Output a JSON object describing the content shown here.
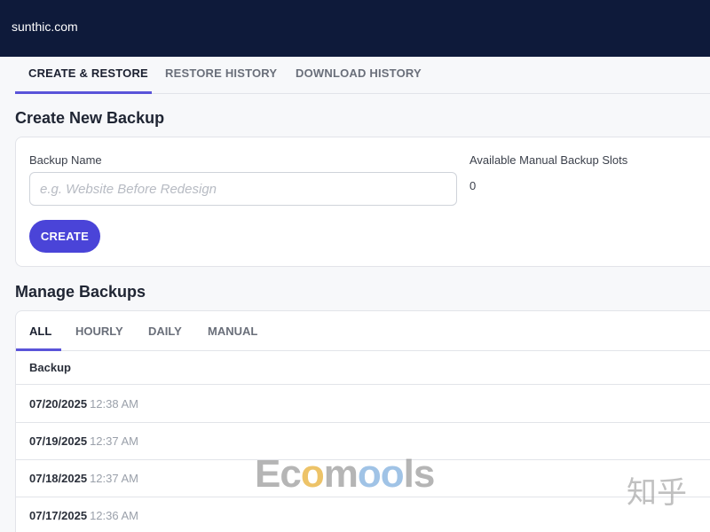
{
  "header": {
    "site_name": "sunthic.com"
  },
  "main_tabs": [
    {
      "label": "CREATE & RESTORE",
      "active": true
    },
    {
      "label": "RESTORE HISTORY",
      "active": false
    },
    {
      "label": "DOWNLOAD HISTORY",
      "active": false
    }
  ],
  "create_section": {
    "title": "Create New Backup",
    "name_label": "Backup Name",
    "name_placeholder": "e.g. Website Before Redesign",
    "name_value": "",
    "slots_label": "Available Manual Backup Slots",
    "slots_value": "0",
    "create_label": "CREATE"
  },
  "manage_section": {
    "title": "Manage Backups",
    "tabs": [
      {
        "label": "ALL",
        "active": true
      },
      {
        "label": "HOURLY",
        "active": false
      },
      {
        "label": "DAILY",
        "active": false
      },
      {
        "label": "MANUAL",
        "active": false
      }
    ],
    "column_header": "Backup",
    "rows": [
      {
        "date": "07/20/2025",
        "time": "12:38 AM"
      },
      {
        "date": "07/19/2025",
        "time": "12:37 AM"
      },
      {
        "date": "07/18/2025",
        "time": "12:37 AM"
      },
      {
        "date": "07/17/2025",
        "time": "12:36 AM"
      }
    ]
  },
  "watermark": {
    "brand_a": "Ec",
    "brand_o1": "o",
    "brand_b": "m",
    "brand_o2": "oo",
    "brand_c": "ls",
    "zhihu": "知乎"
  },
  "colors": {
    "topbar": "#0e1a3a",
    "accent": "#4a44d8",
    "tab_underline": "#5a54d9"
  }
}
